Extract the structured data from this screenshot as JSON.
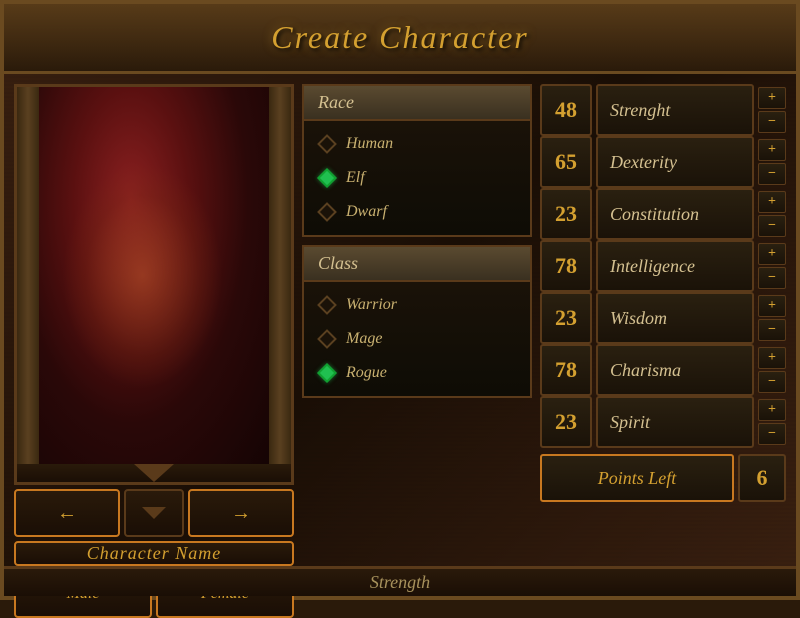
{
  "title": "Create Character",
  "portrait": {
    "nav_prev": "←",
    "nav_next": "→"
  },
  "char_name": "Character Name",
  "gender": {
    "male": "Male",
    "female": "Female"
  },
  "race": {
    "label": "Race",
    "options": [
      {
        "name": "Human",
        "selected": false
      },
      {
        "name": "Elf",
        "selected": true
      },
      {
        "name": "Dwarf",
        "selected": false
      }
    ]
  },
  "class": {
    "label": "Class",
    "options": [
      {
        "name": "Warrior",
        "selected": false
      },
      {
        "name": "Mage",
        "selected": false
      },
      {
        "name": "Rogue",
        "selected": true
      }
    ]
  },
  "stats": [
    {
      "value": "48",
      "name": "Strenght"
    },
    {
      "value": "65",
      "name": "Dexterity"
    },
    {
      "value": "23",
      "name": "Constitution"
    },
    {
      "value": "78",
      "name": "Intelligence"
    },
    {
      "value": "23",
      "name": "Wisdom"
    },
    {
      "value": "78",
      "name": "Charisma"
    },
    {
      "value": "23",
      "name": "Spirit"
    }
  ],
  "points": {
    "label": "Points Left",
    "value": "6"
  },
  "bottom": {
    "text": "Strength"
  }
}
